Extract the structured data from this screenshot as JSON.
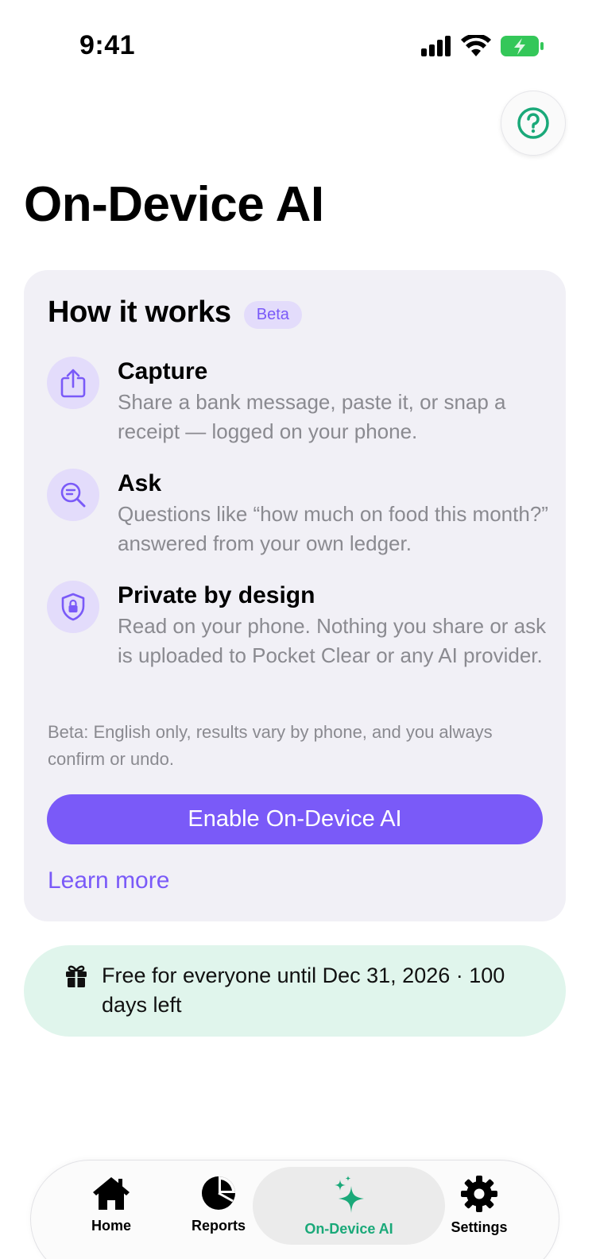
{
  "status_bar": {
    "time": "9:41"
  },
  "header": {
    "help_icon": "question-circle-icon",
    "title": "On-Device AI"
  },
  "card": {
    "title": "How it works",
    "badge": "Beta",
    "features": [
      {
        "icon": "share-upload-icon",
        "title": "Capture",
        "description": "Share a bank message, paste it, or snap a receipt — logged on your phone."
      },
      {
        "icon": "search-text-icon",
        "title": "Ask",
        "description": "Questions like “how much on food this month?” answered from your own ledger."
      },
      {
        "icon": "shield-lock-icon",
        "title": "Private by design",
        "description": "Read on your phone. Nothing you share or ask is uploaded to Pocket Clear or any AI provider."
      }
    ],
    "note": "Beta: English only, results vary by phone, and you always confirm or undo.",
    "enable_button": "Enable On-Device AI",
    "learn_more": "Learn more"
  },
  "promo": {
    "icon": "gift-icon",
    "text": "Free for everyone until Dec 31, 2026 · 100 days left"
  },
  "tab_bar": {
    "tabs": [
      {
        "icon": "home-icon",
        "label": "Home",
        "active": false
      },
      {
        "icon": "pie-chart-icon",
        "label": "Reports",
        "active": false
      },
      {
        "icon": "sparkles-icon",
        "label": "On-Device AI",
        "active": true
      },
      {
        "icon": "gear-icon",
        "label": "Settings",
        "active": false
      }
    ]
  },
  "colors": {
    "accent": "#7a5af8",
    "accent_soft": "#e3dcfb",
    "success": "#1aa979",
    "promo_bg": "#e0f5ec",
    "card_bg": "#f1f0f6",
    "muted_text": "#8a8a90"
  }
}
